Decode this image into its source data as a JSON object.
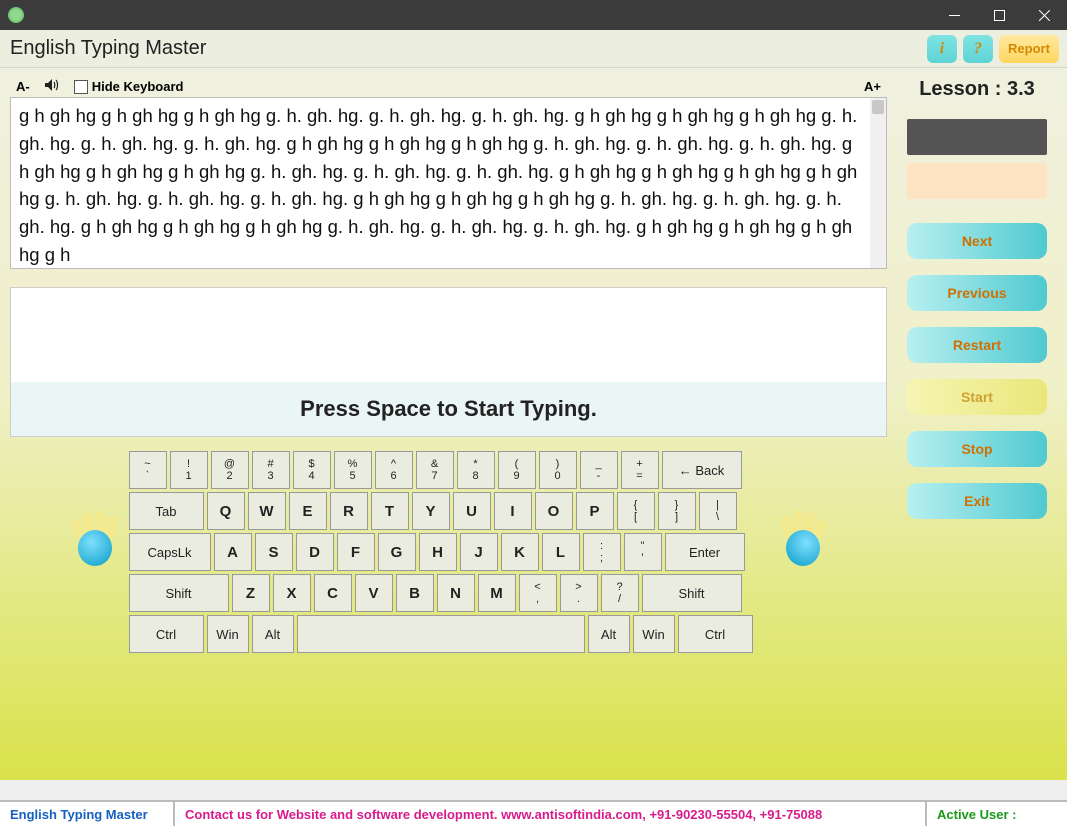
{
  "window": {
    "title": "English Typing Master"
  },
  "header": {
    "info_label": "i",
    "help_label": "?",
    "report_label": "Report"
  },
  "toolbar": {
    "a_minus": "A-",
    "hide_keyboard": "Hide Keyboard",
    "a_plus": "A+"
  },
  "lesson_text": "g h gh hg g h gh hg g h gh hg g. h. gh. hg. g. h. gh. hg. g. h. gh. hg. g h gh hg g h gh hg g h gh hg g. h. gh. hg. g. h. gh. hg. g. h. gh. hg. g h gh hg g h gh hg g h gh hg g. h. gh. hg. g. h. gh. hg. g. h. gh. hg. g h gh hg g h gh hg g h gh hg g. h. gh. hg. g. h. gh. hg. g. h. gh. hg. g h gh hg g h gh hg g h gh hg g h gh hg g. h. gh. hg. g. h. gh. hg. g. h. gh. hg. g h gh hg g h gh hg g h gh hg g. h. gh. hg. g. h. gh. hg. g. h. gh. hg. g h gh hg g h gh hg g h gh hg g. h. gh. hg. g. h. gh. hg. g. h. gh. hg. g h gh hg g h gh hg g h gh hg g h",
  "prompt": "Press Space to Start Typing.",
  "lesson_label": "Lesson : 3.3",
  "sidebar": {
    "next": "Next",
    "previous": "Previous",
    "restart": "Restart",
    "start": "Start",
    "stop": "Stop",
    "exit": "Exit"
  },
  "keyboard": {
    "row1": [
      {
        "t": "~",
        "b": "`"
      },
      {
        "t": "!",
        "b": "1"
      },
      {
        "t": "@",
        "b": "2"
      },
      {
        "t": "#",
        "b": "3"
      },
      {
        "t": "$",
        "b": "4"
      },
      {
        "t": "%",
        "b": "5"
      },
      {
        "t": "^",
        "b": "6"
      },
      {
        "t": "&",
        "b": "7"
      },
      {
        "t": "*",
        "b": "8"
      },
      {
        "t": "(",
        "b": "9"
      },
      {
        "t": ")",
        "b": "0"
      },
      {
        "t": "_",
        "b": "-"
      },
      {
        "t": "+",
        "b": "="
      }
    ],
    "back": "← Back",
    "tab": "Tab",
    "row2": [
      "Q",
      "W",
      "E",
      "R",
      "T",
      "Y",
      "U",
      "I",
      "O",
      "P"
    ],
    "row2b": [
      {
        "t": "{",
        "b": "["
      },
      {
        "t": "}",
        "b": "]"
      },
      {
        "t": "|",
        "b": "\\"
      }
    ],
    "caps": "CapsLk",
    "row3": [
      "A",
      "S",
      "D",
      "F",
      "G",
      "H",
      "J",
      "K",
      "L"
    ],
    "row3b": [
      {
        "t": ":",
        "b": ";"
      },
      {
        "t": "\"",
        "b": "'"
      }
    ],
    "enter": "Enter",
    "shift": "Shift",
    "row4": [
      "Z",
      "X",
      "C",
      "V",
      "B",
      "N",
      "M"
    ],
    "row4b": [
      {
        "t": "<",
        "b": ","
      },
      {
        "t": ">",
        "b": "."
      },
      {
        "t": "?",
        "b": "/"
      }
    ],
    "ctrl": "Ctrl",
    "win": "Win",
    "alt": "Alt"
  },
  "status": {
    "name": "English Typing Master",
    "msg": "Contact us for Website and software development. www.antisoftindia.com, +91-90230-55504, +91-75088",
    "user": "Active User :"
  }
}
